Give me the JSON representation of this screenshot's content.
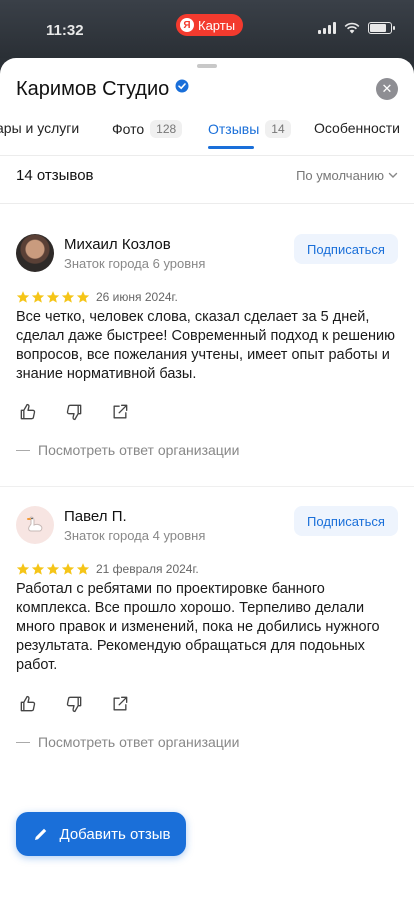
{
  "status_bar": {
    "time": "11:32",
    "app_badge": "Карты",
    "app_badge_logo": "Я"
  },
  "header": {
    "title": "Каримов Студио",
    "close_icon": "close-icon"
  },
  "tabs": [
    {
      "label": "ары и услуги",
      "count": ""
    },
    {
      "label": "Фото",
      "count": "128"
    },
    {
      "label": "Отзывы",
      "count": "14",
      "active": true
    },
    {
      "label": "Особенности",
      "count": ""
    }
  ],
  "reviews_header": {
    "count_label": "14 отзывов",
    "sort_label": "По умолчанию"
  },
  "reviews": [
    {
      "name": "Михаил Козлов",
      "level": "Знаток города 6 уровня",
      "subscribe_label": "Подписаться",
      "rating": 5,
      "date": "26 июня 2024г.",
      "text": "Все четко, человек слова, сказал сделает за 5 дней, сделал даже быстрее! Современный подход к решению вопросов, все пожелания учтены, имеет опыт работы и знание нормативной базы.",
      "org_reply_label": "Посмотреть ответ организации"
    },
    {
      "name": "Павел П.",
      "level": "Знаток города 4 уровня",
      "subscribe_label": "Подписаться",
      "rating": 5,
      "date": "21 февраля 2024г.",
      "text": "Работал с ребятами по проектировке банного комплекса. Все прошло хорошо. Терпеливо делали много правок и изменений, пока не добились нужного результата. Рекомендую обращаться для подоьных работ.",
      "org_reply_label": "Посмотреть ответ организации"
    }
  ],
  "fab": {
    "label": "Добавить отзыв",
    "icon": "pencil-icon"
  },
  "colors": {
    "accent": "#1a6fd9",
    "star": "#f5c518",
    "badge_red": "#f33a2e"
  }
}
